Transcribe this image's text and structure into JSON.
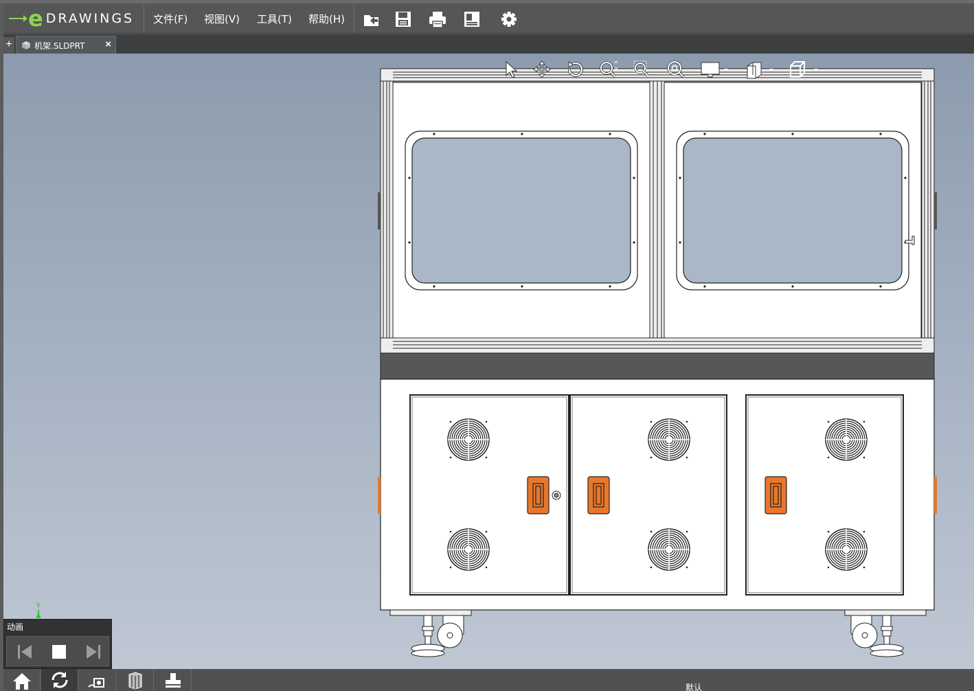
{
  "app": {
    "logo_letter": "e",
    "logo_word": "DRAWINGS",
    "brand_color": "#8fd14f"
  },
  "menu": {
    "items": [
      {
        "label": "文件(F)"
      },
      {
        "label": "视图(V)"
      },
      {
        "label": "工具(T)"
      },
      {
        "label": "帮助(H)"
      }
    ]
  },
  "toolbar": {
    "icons": [
      "open-icon",
      "save-icon",
      "print-icon",
      "stamp-icon",
      "settings-gear-icon"
    ]
  },
  "tabs": {
    "add_label": "+",
    "items": [
      {
        "label": "机架.SLDPRT",
        "close": "×",
        "icon": "part-icon",
        "active": true
      }
    ]
  },
  "view_toolbar": {
    "icons": [
      "select-arrow-icon",
      "pan-icon",
      "rotate-icon",
      "zoom-icon",
      "zoom-to-area-icon",
      "zoom-to-fit-icon",
      "display-style-icon",
      "section-view-icon",
      "standard-views-icon"
    ]
  },
  "triad": {
    "axis_label": "Y",
    "color": "#2fc42f"
  },
  "animation": {
    "title": "动画",
    "buttons": [
      "previous-frame-icon",
      "stop-icon",
      "next-frame-icon"
    ]
  },
  "bottom_bar": {
    "buttons": [
      "home-icon",
      "reset-view-icon",
      "markup-icon",
      "components-icon",
      "stamp-icon"
    ],
    "configuration": "默认"
  },
  "colors": {
    "handle_orange": "#e8772a",
    "viewport_top": "#8c9bad",
    "viewport_bottom": "#bfc7d3"
  }
}
